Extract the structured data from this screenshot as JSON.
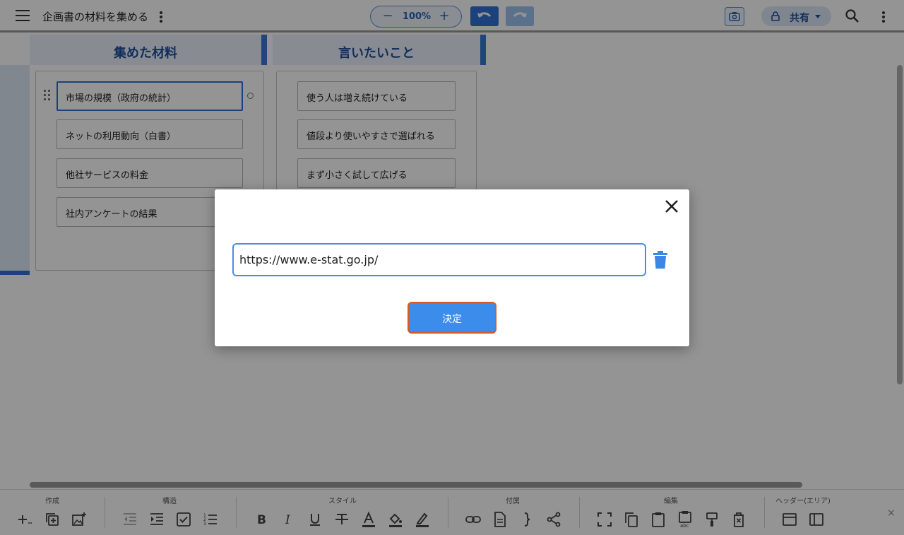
{
  "header": {
    "doc_title": "企画書の材料を集める",
    "zoom_minus": "−",
    "zoom_value": "100%",
    "zoom_plus": "+",
    "share_label": "共有"
  },
  "board": {
    "columns": [
      {
        "title": "集めた材料",
        "cards": [
          "市場の規模（政府の統計）",
          "ネットの利用動向（白書）",
          "他社サービスの料金",
          "社内アンケートの結果"
        ]
      },
      {
        "title": "言いたいこと",
        "cards": [
          "使う人は増え続けている",
          "値段より使いやすさで選ばれる",
          "まず小さく試して広げる"
        ]
      }
    ]
  },
  "toolbar": {
    "groups": [
      "作成",
      "構造",
      "スタイル",
      "付属",
      "編集",
      "ヘッダー(エリア)"
    ],
    "close": "×"
  },
  "dialog": {
    "url_value": "https://www.e-stat.go.jp/",
    "ok_label": "決定"
  },
  "colors": {
    "accent": "#2f72d6",
    "header_text": "#1e4f9a",
    "ok_button": "#3b8ceb",
    "ok_border": "#d65a24"
  }
}
